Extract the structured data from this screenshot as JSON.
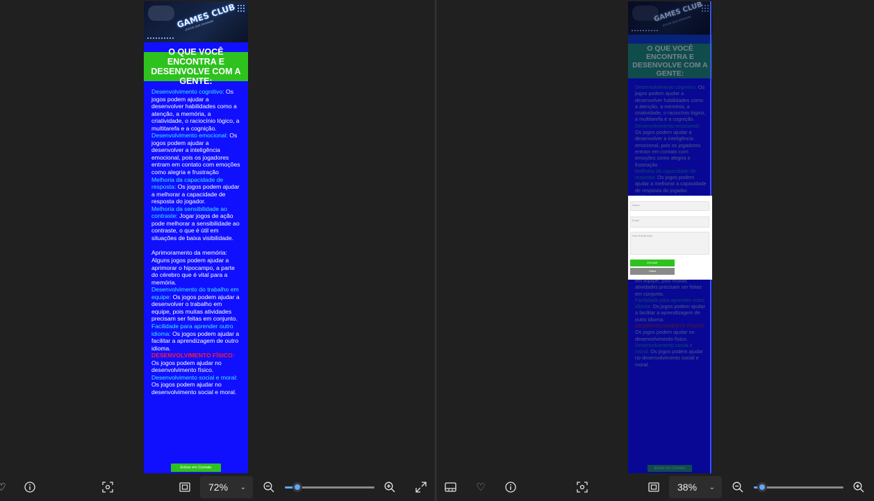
{
  "site": {
    "logo_text": "GAMES CLUB",
    "logo_sub": "JOGOS QUE ENSINAM",
    "heading": "O QUE VOCÊ ENCONTRA E DESENVOLVE COM A GENTE:",
    "sections": [
      {
        "title": "Desenvolvimento cognitivo:",
        "text": " Os jogos podem ajudar a desenvolver habilidades como a atenção, a memória, a criatividade, o raciocínio lógico, a multitarefa e a cognição."
      },
      {
        "title": "Desenvolvimento emocional:",
        "text": " Os jogos podem ajudar a desenvolver a inteligência emocional, pois os jogadores entram em contato com emoções como alegria e frustração"
      },
      {
        "title": "Melhoria da capacidade de resposta:",
        "text": " Os jogos podem ajudar a melhorar a capacidade de resposta do jogador."
      },
      {
        "title": "Melhoria da sensibilidade ao contraste:",
        "text": " Jogar jogos de ação pode melhorar a sensibilidade ao contraste, o que é útil em situações de baixa visibilidade."
      },
      {
        "title": "",
        "text": "Aprimoramento da memória: Alguns jogos podem ajudar a aprimorar o hipocampo, a parte do cérebro que é vital para a memória."
      },
      {
        "title": "Desenvolvimento do trabalho em equipe:",
        "text": " Os jogos podem ajudar a desenvolver o trabalho em equipe, pois muitas atividades precisam ser feitas em conjunto."
      },
      {
        "title": "Facilidade para aprender outro idioma:",
        "text": " Os jogos podem ajudar a facilitar a aprendizagem de outro idioma."
      },
      {
        "title": "DESENVOLVIMENTO FÍSICO:",
        "text": " Os jogos podem ajudar no desenvolvimento físico."
      },
      {
        "title": "Desenvolvimento social e moral:",
        "text": " Os jogos podem ajudar no desenvolvimento social e moral."
      }
    ],
    "cta_label": "Entrar em Contato"
  },
  "modal": {
    "name_placeholder": "Nome",
    "email_placeholder": "Email",
    "message_placeholder": "Sua dúvida aqui",
    "send_label": "ENVIAR",
    "back_label": "Voltar"
  },
  "left_toolbar": {
    "zoom": "72%",
    "zoom_fraction": 0.1
  },
  "right_toolbar": {
    "zoom": "38%",
    "zoom_fraction": 0.05
  },
  "colors": {
    "accent": "#60a8ff",
    "page_bg": "#1010ff",
    "heading_bg": "#2ec21e",
    "highlight": "#40e8ff",
    "red": "#ff1a3a"
  },
  "icons": [
    "heart-icon",
    "info-icon",
    "crop-icon",
    "fit-icon",
    "zoom-out-icon",
    "zoom-in-icon",
    "expand-icon",
    "filmstrip-icon"
  ]
}
